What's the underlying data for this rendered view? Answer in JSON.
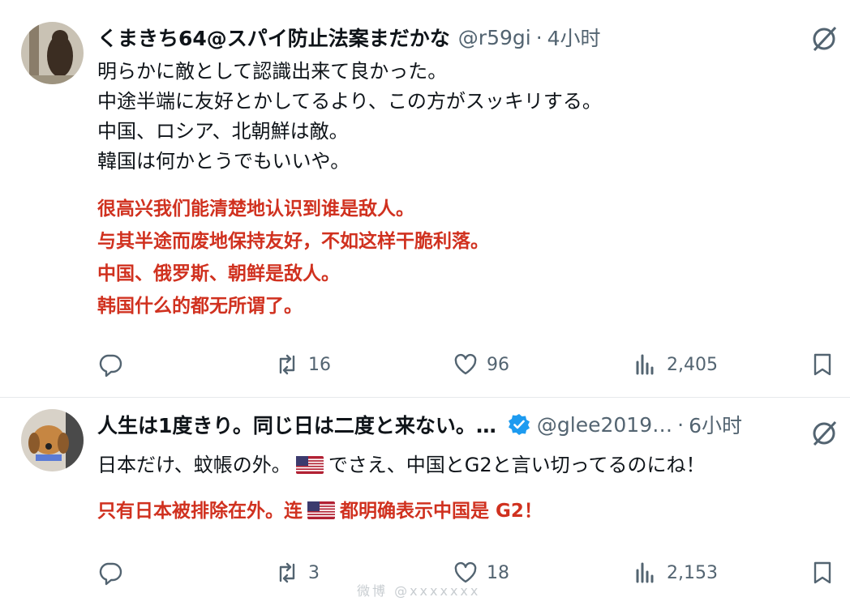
{
  "tweets": [
    {
      "user": {
        "name": "くまきち64@スパイ防止法案まだかな",
        "handle": "@r59gi",
        "time": "4小时"
      },
      "text_lines": [
        "明らかに敵として認識出来て良かった。",
        "中途半端に友好とかしてるより、この方がスッキリする。",
        "中国、ロシア、北朝鮮は敵。",
        "韓国は何かとうでもいいや。"
      ],
      "translation_lines": [
        "很高兴我们能清楚地认识到谁是敌人。",
        "与其半途而废地保持友好，不如这样干脆利落。",
        "中国、俄罗斯、朝鲜是敌人。",
        "韩国什么的都无所谓了。"
      ],
      "stats": {
        "retweets": "16",
        "likes": "96",
        "views": "2,405"
      }
    },
    {
      "user": {
        "name": "人生は1度きり。同じ日は二度と来ない。…",
        "handle": "@glee2019…",
        "time": "6小时"
      },
      "text_pre": "日本だけ、蚊帳の外。",
      "text_post": "でさえ、中国とG2と言い切ってるのにね！",
      "translation_pre": "只有日本被排除在外。连",
      "translation_post": "都明确表示中国是 G2！",
      "stats": {
        "retweets": "3",
        "likes": "18",
        "views": "2,153"
      }
    }
  ],
  "watermark": "微博 @xxxxxxx",
  "colors": {
    "translation": "#d0311f",
    "secondary": "#536471",
    "verified": "#1d9bf0"
  },
  "icons": [
    "reply-icon",
    "retweet-icon",
    "like-icon",
    "views-icon",
    "bookmark-icon",
    "grok-icon",
    "verified-icon",
    "us-flag-icon"
  ]
}
